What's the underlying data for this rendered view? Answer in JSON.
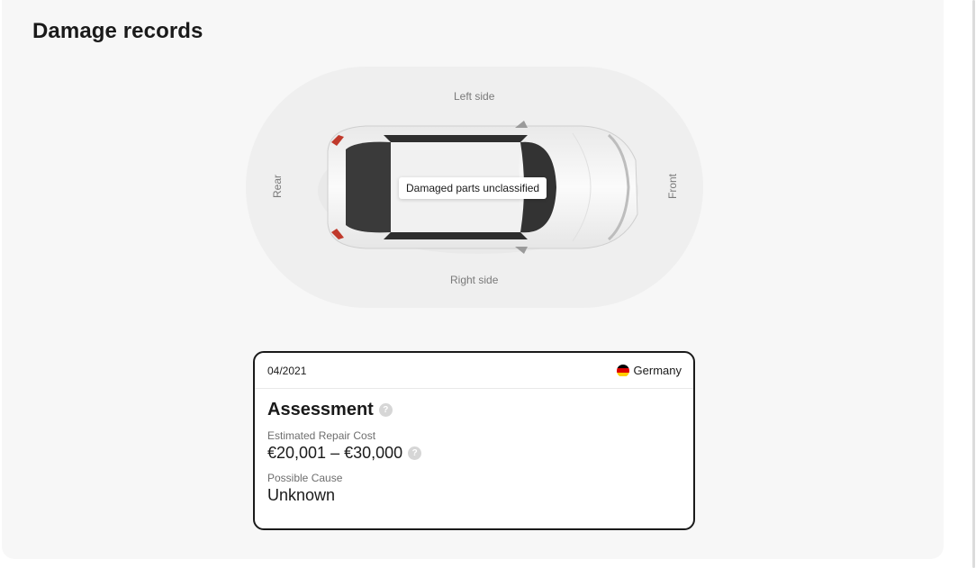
{
  "page": {
    "title": "Damage records"
  },
  "diagram": {
    "left_side_label": "Left side",
    "right_side_label": "Right side",
    "rear_label": "Rear",
    "front_label": "Front",
    "tooltip": "Damaged parts unclassified"
  },
  "record": {
    "date": "04/2021",
    "country": "Germany",
    "flag_colors": [
      "#000000",
      "#dd0000",
      "#ffce00"
    ],
    "heading": "Assessment",
    "help_glyph": "?",
    "repair_cost_label": "Estimated Repair Cost",
    "repair_cost_value": "€20,001 – €30,000",
    "cause_label": "Possible Cause",
    "cause_value": "Unknown"
  },
  "icons": {
    "help": "question-mark-circle-icon",
    "flag": "germany-flag-icon",
    "car": "car-top-view-illustration"
  }
}
